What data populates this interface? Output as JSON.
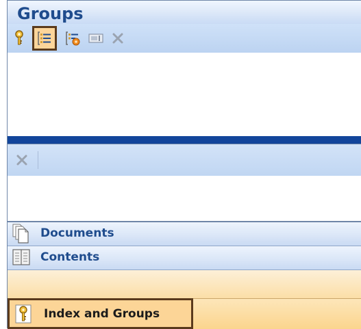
{
  "panel": {
    "title": "Groups"
  },
  "toolbar_top": {
    "icons": [
      "key-icon",
      "list-view-icon",
      "list-settings-icon",
      "rename-icon",
      "delete-icon"
    ]
  },
  "toolbar_second": {
    "icons": [
      "delete-icon"
    ]
  },
  "nav": {
    "items": [
      {
        "label": "Documents",
        "icon": "documents-icon"
      },
      {
        "label": "Contents",
        "icon": "contents-book-icon"
      },
      {
        "label": "Index and Groups",
        "icon": "key-icon",
        "active": true
      }
    ]
  },
  "colors": {
    "title": "#1f4c8d",
    "active_fill": "#fcd59a",
    "active_border": "#5a3a1c",
    "divider": "#12459b"
  }
}
